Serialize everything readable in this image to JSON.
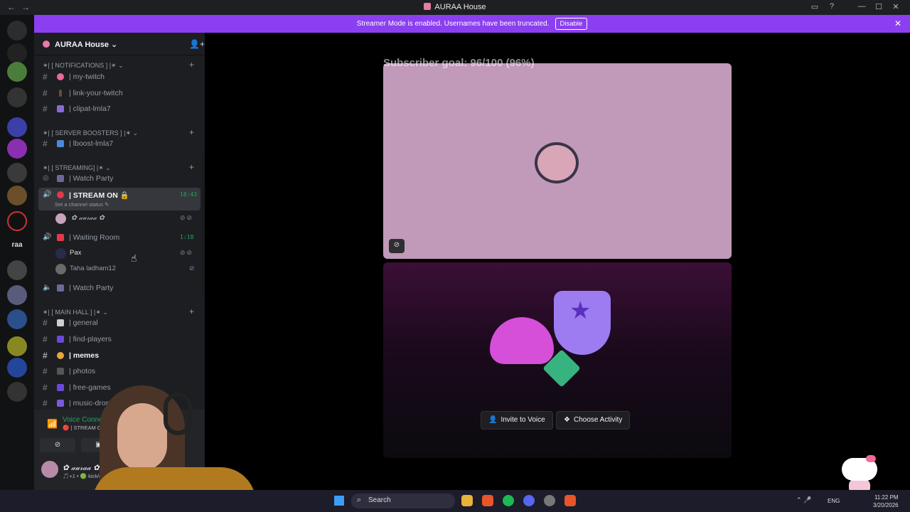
{
  "window": {
    "title": "AURAA House",
    "nav_back": "←",
    "nav_fwd": "→",
    "controls": [
      "▭",
      "?",
      "—",
      "☐",
      "✕"
    ]
  },
  "banner": {
    "text": "Streamer Mode is enabled. Usernames have been truncated.",
    "button": "Disable",
    "close": "✕"
  },
  "server": {
    "name": "AURAA House ⌄",
    "add_member": "👤+"
  },
  "categories": {
    "notifications": "✶| [ NOTIFICATIONS ] |✶ ⌄",
    "boosters": "✶| [ SERVER BOOSTERS ] |✶ ⌄",
    "streaming": "✶| [ STREAMING] |✶ ⌄",
    "main_hall": "✶| [ MAIN HALL ] |✶ ⌄",
    "plus": "+"
  },
  "channels": {
    "my_twitch": "| my-twitch",
    "link_twitch": "| link-your-twitch",
    "clipat": "| clipat-lmla7",
    "lboost": "| lboost-lmla7",
    "watch_party_stage": "| Watch Party",
    "stream_on": "| STREAM ON 🔒",
    "stream_on_timer": "18:43",
    "stream_on_status": "Set a channel status ✎",
    "waiting_room": "| Waiting Room",
    "waiting_room_timer": "1:18",
    "watch_party_voice": "| Watch Party",
    "general": "| general",
    "find_players": "| find-players",
    "memes": "| memes",
    "photos": "| photos",
    "free_games": "| free-games",
    "music_drop": "| music-drop"
  },
  "hash": "#",
  "voice_users": {
    "auraa": "✿ 𝒶𝓊𝓇𝒶𝒶 ✿",
    "pax": "Pax",
    "taha": "Taha ladham12"
  },
  "panel": {
    "voice_connected": "Voice Connected",
    "voice_sub": "🔴 | STREAM ON 🔒 / AURAA...",
    "me_name": "✿ 𝒶𝓊𝓇𝒶𝒶 ✿",
    "me_sub": "🎵+1 • 🟢 kick/onlyauraa"
  },
  "stage": {
    "goal_text": "Subscriber goal: 96/100 (96%)",
    "invite_button": "Invite to Voice",
    "activity_button": "Choose Activity"
  },
  "taskbar": {
    "search": "Search",
    "lang": "ENG",
    "time": "11:22 PM",
    "date": "3/20/2026"
  },
  "guild_label": "raa",
  "colors": {
    "banner": "#8b3ff0",
    "voice_green": "#23a55a",
    "tile_pink": "#c09ab8"
  }
}
